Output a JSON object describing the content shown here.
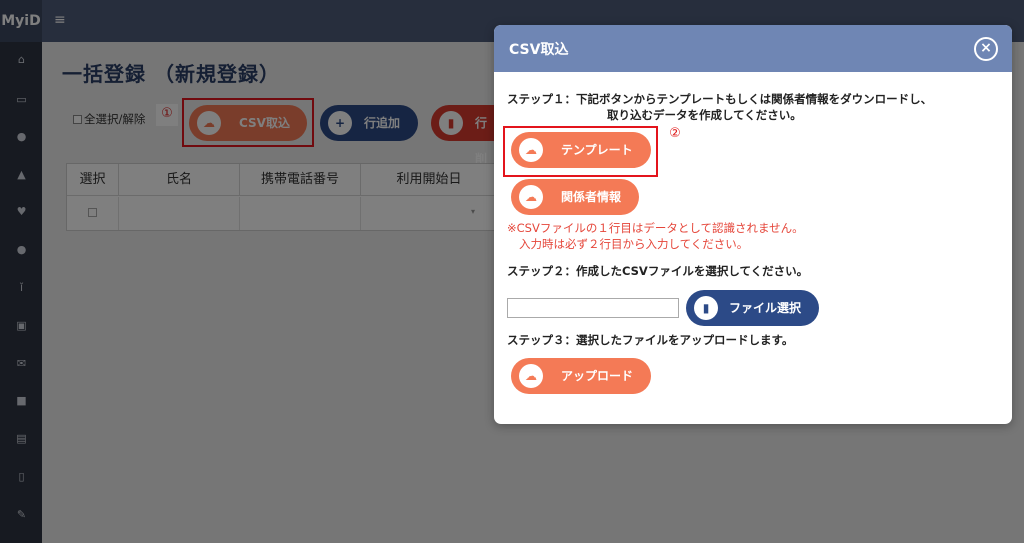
{
  "app": {
    "brand": "MyiD",
    "menu_icon": "hamburger-icon"
  },
  "sidebar": {
    "icons": [
      "home-icon",
      "id-card-icon",
      "users-icon",
      "bell-icon",
      "heart-icon",
      "group-icon",
      "walk-icon",
      "calendar-check-icon",
      "mail-icon",
      "book-icon",
      "train-icon",
      "clipboard-icon",
      "pencil-icon"
    ]
  },
  "page": {
    "title": "一括登録 （新規登録）",
    "select_all_label": "全選択/解除",
    "marker1": "①",
    "csv_import_label": "CSV取込",
    "add_row_label": "行追加",
    "delete_row_label": "行削",
    "table": {
      "headers": [
        "選択",
        "氏名",
        "携帯電話番号",
        "利用開始日"
      ]
    }
  },
  "modal": {
    "title": "CSV取込",
    "close_icon": "close-icon",
    "step1_line1": "ステップ１：下記ボタンからテンプレートもしくは関係者情報をダウンロードし、",
    "step1_line2": "取り込むデータを作成してください。",
    "marker2": "②",
    "template_label": "テンプレート",
    "related_info_label": "関係者情報",
    "note_line1": "※CSVファイルの１行目はデータとして認識されません。",
    "note_line2": "入力時は必ず２行目から入力してください。",
    "step2": "ステップ２：作成したCSVファイルを選択してください。",
    "file_input_value": "",
    "file_select_label": "ファイル選択",
    "step3": "ステップ３：選択したファイルをアップロードします。",
    "upload_label": "アップロード"
  },
  "colors": {
    "header": "#4e5c7a",
    "sidebar": "#2f3542",
    "orange": "#f47a56",
    "navy": "#2c4a87",
    "modal_header": "#6f86b4",
    "highlight": "#e3141c",
    "note": "#e5463a"
  }
}
